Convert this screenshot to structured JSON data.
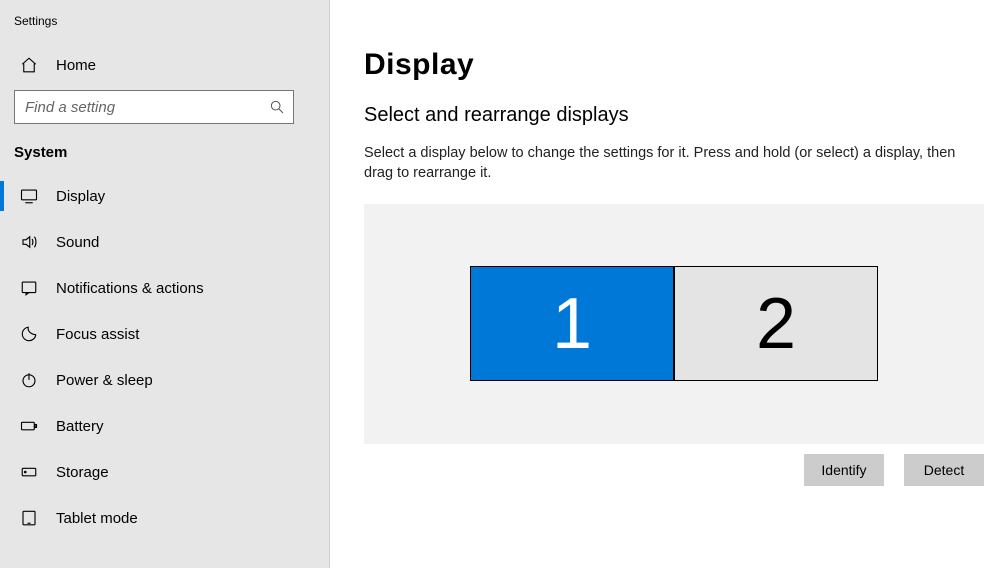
{
  "window": {
    "title": "Settings"
  },
  "sidebar": {
    "home_label": "Home",
    "search_placeholder": "Find a setting",
    "section_label": "System",
    "items": [
      {
        "label": "Display",
        "selected": true
      },
      {
        "label": "Sound"
      },
      {
        "label": "Notifications & actions"
      },
      {
        "label": "Focus assist"
      },
      {
        "label": "Power & sleep"
      },
      {
        "label": "Battery"
      },
      {
        "label": "Storage"
      },
      {
        "label": "Tablet mode"
      }
    ]
  },
  "main": {
    "title": "Display",
    "section_heading": "Select and rearrange displays",
    "section_desc": "Select a display below to change the settings for it. Press and hold (or select) a display, then drag to rearrange it.",
    "monitors": [
      {
        "number": "1",
        "active": true
      },
      {
        "number": "2",
        "active": false
      }
    ],
    "buttons": {
      "identify": "Identify",
      "detect": "Detect"
    }
  }
}
